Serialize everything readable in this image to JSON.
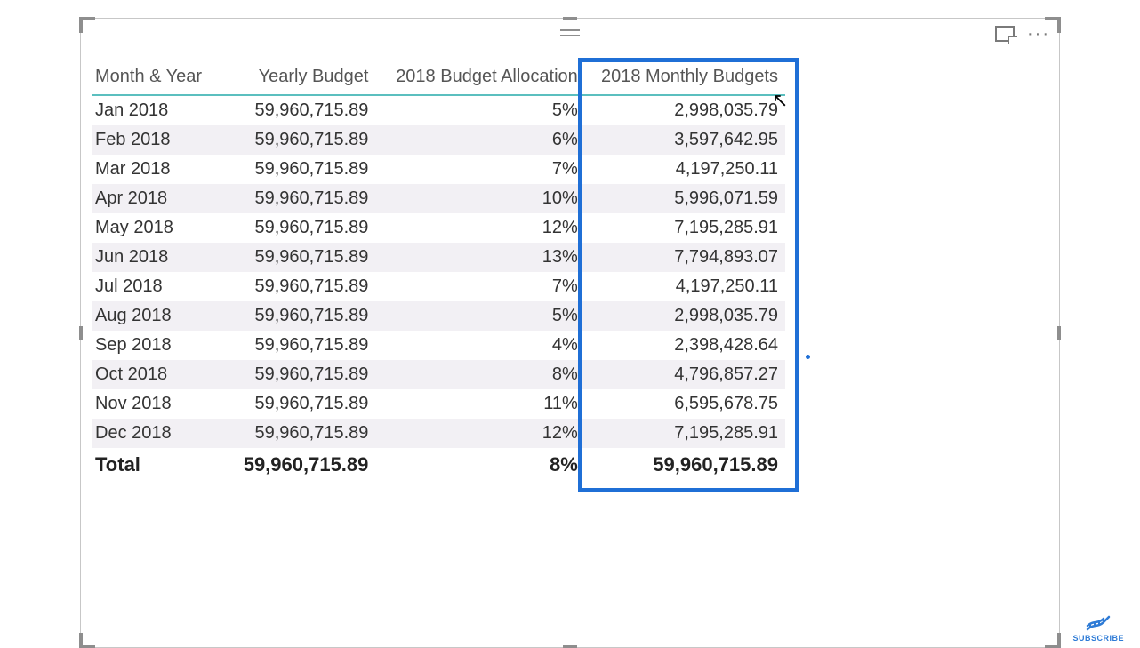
{
  "table": {
    "headers": {
      "month_year": "Month & Year",
      "yearly_budget": "Yearly Budget",
      "allocation": "2018 Budget Allocation",
      "monthly_budget": "2018 Monthly Budgets"
    },
    "rows": [
      {
        "month_year": "Jan 2018",
        "yearly_budget": "59,960,715.89",
        "allocation": "5%",
        "monthly_budget": "2,998,035.79"
      },
      {
        "month_year": "Feb 2018",
        "yearly_budget": "59,960,715.89",
        "allocation": "6%",
        "monthly_budget": "3,597,642.95"
      },
      {
        "month_year": "Mar 2018",
        "yearly_budget": "59,960,715.89",
        "allocation": "7%",
        "monthly_budget": "4,197,250.11"
      },
      {
        "month_year": "Apr 2018",
        "yearly_budget": "59,960,715.89",
        "allocation": "10%",
        "monthly_budget": "5,996,071.59"
      },
      {
        "month_year": "May 2018",
        "yearly_budget": "59,960,715.89",
        "allocation": "12%",
        "monthly_budget": "7,195,285.91"
      },
      {
        "month_year": "Jun 2018",
        "yearly_budget": "59,960,715.89",
        "allocation": "13%",
        "monthly_budget": "7,794,893.07"
      },
      {
        "month_year": "Jul 2018",
        "yearly_budget": "59,960,715.89",
        "allocation": "7%",
        "monthly_budget": "4,197,250.11"
      },
      {
        "month_year": "Aug 2018",
        "yearly_budget": "59,960,715.89",
        "allocation": "5%",
        "monthly_budget": "2,998,035.79"
      },
      {
        "month_year": "Sep 2018",
        "yearly_budget": "59,960,715.89",
        "allocation": "4%",
        "monthly_budget": "2,398,428.64"
      },
      {
        "month_year": "Oct 2018",
        "yearly_budget": "59,960,715.89",
        "allocation": "8%",
        "monthly_budget": "4,796,857.27"
      },
      {
        "month_year": "Nov 2018",
        "yearly_budget": "59,960,715.89",
        "allocation": "11%",
        "monthly_budget": "6,595,678.75"
      },
      {
        "month_year": "Dec 2018",
        "yearly_budget": "59,960,715.89",
        "allocation": "12%",
        "monthly_budget": "7,195,285.91"
      }
    ],
    "total": {
      "label": "Total",
      "yearly_budget": "59,960,715.89",
      "allocation": "8%",
      "monthly_budget": "59,960,715.89"
    }
  },
  "subscribe_label": "SUBSCRIBE"
}
